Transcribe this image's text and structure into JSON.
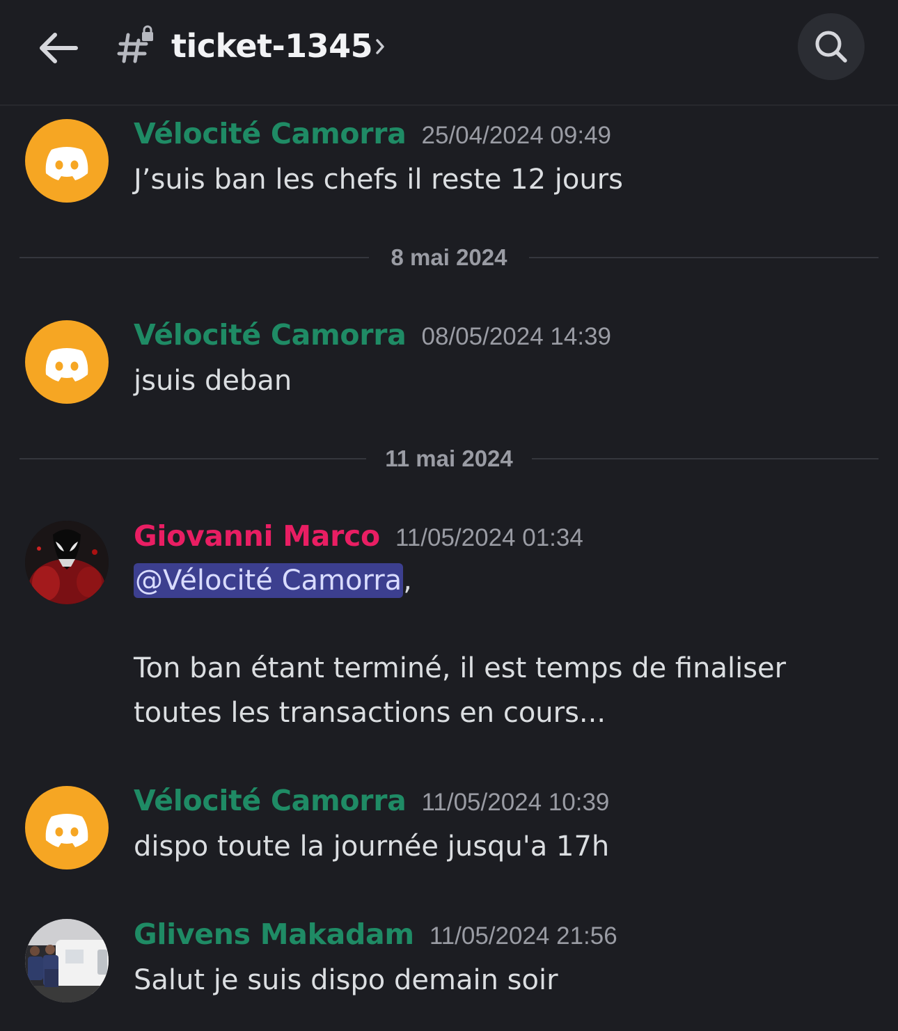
{
  "header": {
    "back_icon": "arrow-left-icon",
    "channel_icon": "locked-hashtag-icon",
    "channel_name": "ticket-1345",
    "chevron_icon": "chevron-right-icon",
    "search_icon": "search-icon"
  },
  "colors": {
    "background": "#1c1d22",
    "velocite_name": "#1f8b65",
    "giovanni_name": "#e91e63",
    "glivens_name": "#1f8b65",
    "discord_avatar": "#f6a623",
    "mention_bg": "#3c3f8f"
  },
  "messages": [
    {
      "author": "Vélocité Camorra",
      "timestamp": "25/04/2024 09:49",
      "text": "J’suis ban les chefs il reste 12 jours"
    },
    {
      "author": "Vélocité Camorra",
      "timestamp": "08/05/2024 14:39",
      "text": "jsuis deban"
    },
    {
      "author": "Giovanni Marco",
      "timestamp": "11/05/2024 01:34",
      "mention": "@Vélocité Camorra",
      "mention_suffix": ",",
      "text_line1": "Ton ban étant terminé, il est temps de finaliser",
      "text_line2": "toutes les transactions en cours..."
    },
    {
      "author": "Vélocité Camorra",
      "timestamp": "11/05/2024 10:39",
      "text": "dispo toute la journée jusqu'a 17h"
    },
    {
      "author": "Glivens Makadam",
      "timestamp": "11/05/2024 21:56",
      "text": "Salut je suis dispo demain soir"
    }
  ],
  "dividers": [
    {
      "label": "8 mai 2024"
    },
    {
      "label": "11 mai 2024"
    }
  ]
}
